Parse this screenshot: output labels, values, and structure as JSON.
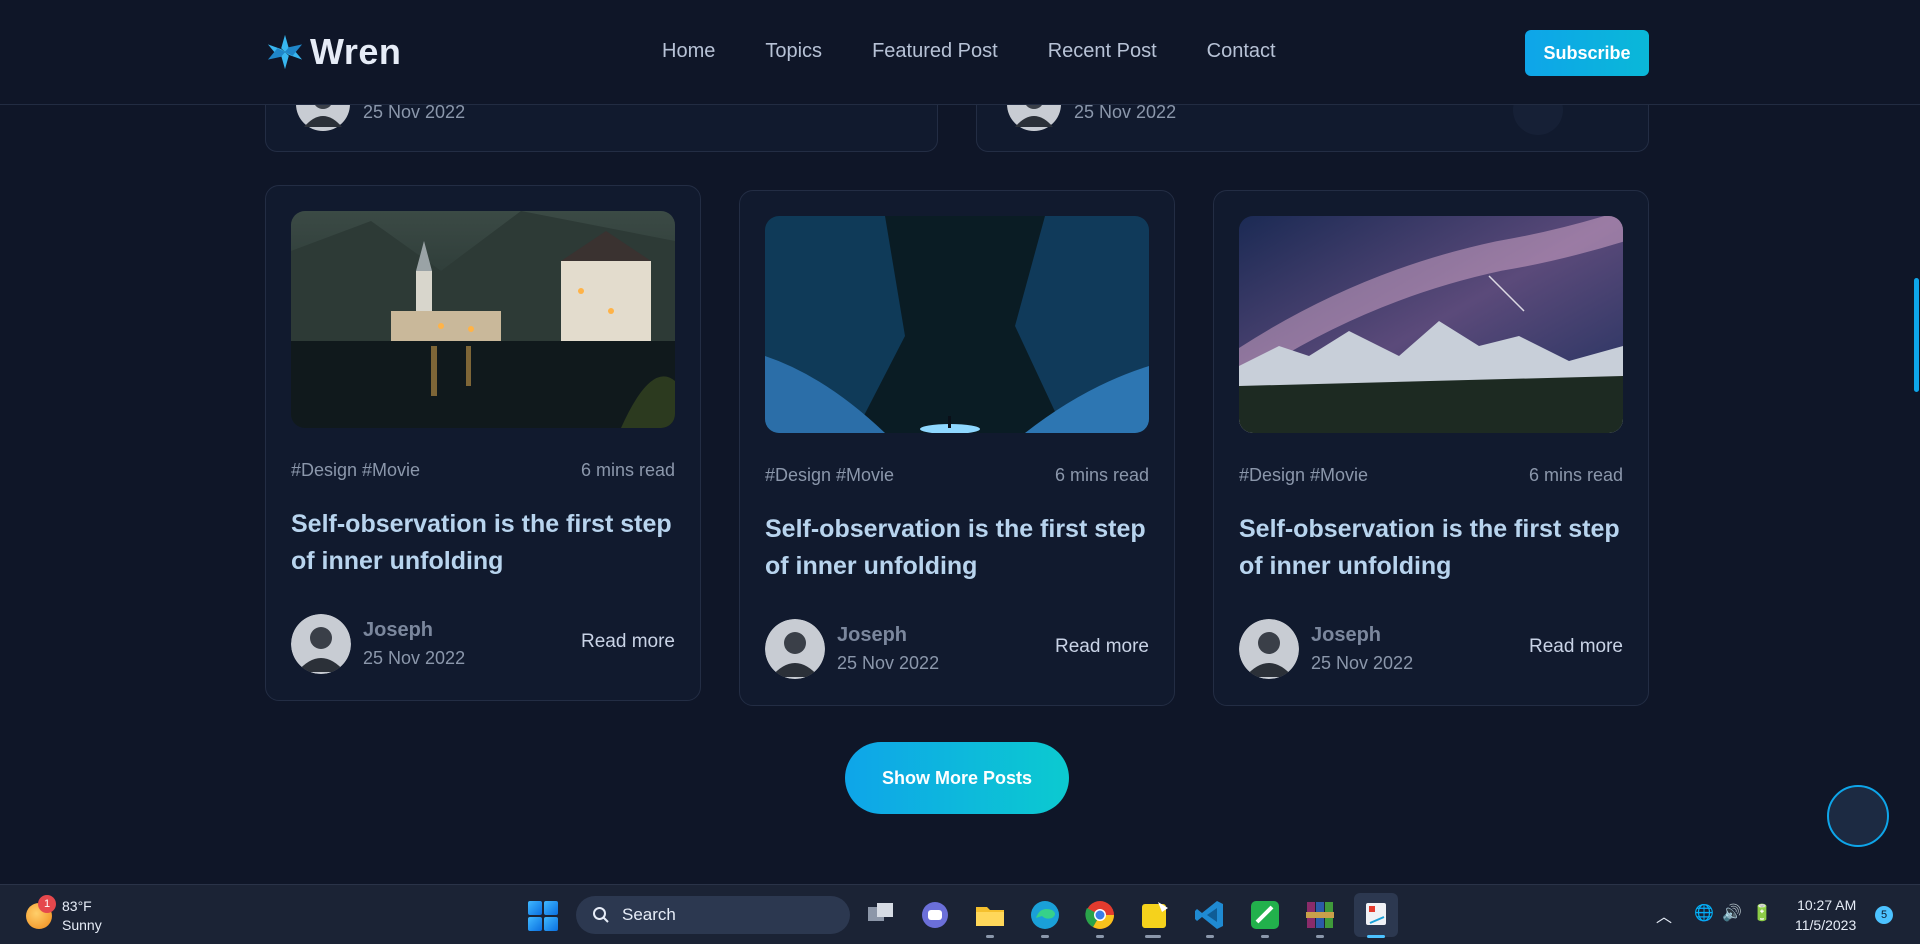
{
  "site": {
    "brand": "Wren",
    "nav": [
      "Home",
      "Topics",
      "Featured Post",
      "Recent Post",
      "Contact"
    ],
    "subscribe_label": "Subscribe",
    "accent_color": "#0ea5e9"
  },
  "top_cards": [
    {
      "date": "25 Nov 2022"
    },
    {
      "date": "25 Nov 2022"
    }
  ],
  "cards": [
    {
      "image": "village-lake-night",
      "tags": "#Design #Movie",
      "read_time": "6 mins read",
      "title": "Self-observation is the first step of inner unfolding",
      "author": "Joseph",
      "date": "25 Nov 2022",
      "read_more": "Read more"
    },
    {
      "image": "aurora-ice-cave",
      "tags": "#Design #Movie",
      "read_time": "6 mins read",
      "title": "Self-observation is the first step of inner unfolding",
      "author": "Joseph",
      "date": "25 Nov 2022",
      "read_more": "Read more"
    },
    {
      "image": "milky-way-mountains",
      "tags": "#Design #Movie",
      "read_time": "6 mins read",
      "title": "Self-observation is the first step of inner unfolding",
      "author": "Joseph",
      "date": "25 Nov 2022",
      "read_more": "Read more"
    }
  ],
  "show_more_label": "Show More Posts",
  "taskbar": {
    "weather_alert_count": "1",
    "temperature": "83°F",
    "condition": "Sunny",
    "search_placeholder": "Search",
    "time": "10:27 AM",
    "date": "11/5/2023",
    "notification_count": "5",
    "apps": [
      "task-view",
      "teams-chat",
      "file-explorer",
      "edge",
      "chrome",
      "player",
      "vscode",
      "green-app",
      "winrar",
      "snipping-tool"
    ]
  }
}
